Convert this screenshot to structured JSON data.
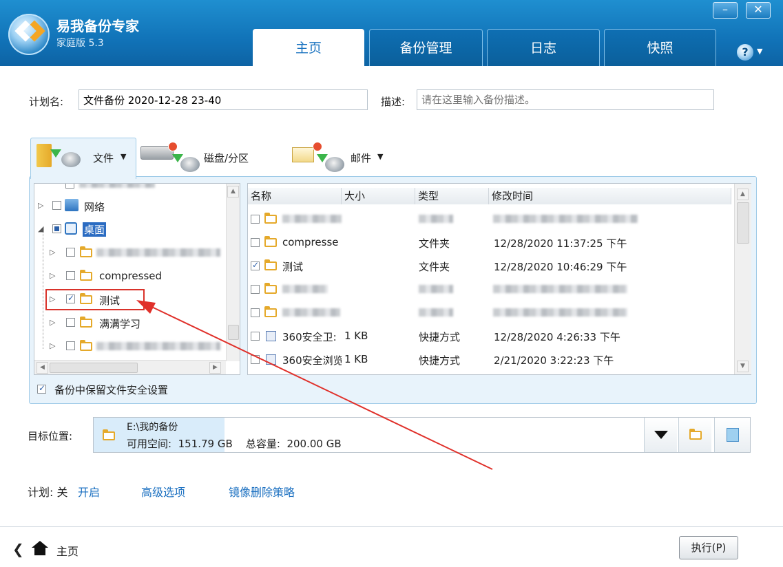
{
  "app": {
    "title": "易我备份专家",
    "subtitle": "家庭版 5.3"
  },
  "window_controls": {
    "minimize": "–",
    "close": "✕"
  },
  "tabs": [
    {
      "label": "主页",
      "active": true
    },
    {
      "label": "备份管理",
      "active": false
    },
    {
      "label": "日志",
      "active": false
    },
    {
      "label": "快照",
      "active": false
    }
  ],
  "help": {
    "label": "?",
    "arrow": "▼"
  },
  "plan": {
    "name_label": "计划名:",
    "name_value": "文件备份 2020-12-28 23-40",
    "desc_label": "描述:",
    "desc_placeholder": "请在这里输入备份描述。"
  },
  "types": {
    "file": {
      "label": "文件",
      "arrow": "▼"
    },
    "disk": {
      "label": "磁盘/分区"
    },
    "mail": {
      "label": "邮件",
      "arrow": "▼"
    }
  },
  "tree": {
    "items": [
      {
        "label": "网络",
        "checked": "none",
        "expander": "▷"
      },
      {
        "label": "桌面",
        "checked": "partial",
        "expander": "◢"
      },
      {
        "label": "",
        "checked": "none",
        "expander": "▷"
      },
      {
        "label": "compressed",
        "checked": "none",
        "expander": "▷"
      },
      {
        "label": "测试",
        "checked": "on",
        "expander": "▷"
      },
      {
        "label": "满满学习",
        "checked": "none",
        "expander": "▷"
      },
      {
        "label": "",
        "checked": "none",
        "expander": "▷"
      }
    ]
  },
  "list": {
    "headers": {
      "name": "名称",
      "size": "大小",
      "type": "类型",
      "modified": "修改时间"
    },
    "rows": [
      {
        "name": "",
        "size": "",
        "type": "",
        "modified": "",
        "checked": false,
        "icon": "folder"
      },
      {
        "name": "compresse",
        "size": "",
        "type": "文件夹",
        "modified": "12/28/2020 11:37:25  下午",
        "checked": false,
        "icon": "folder"
      },
      {
        "name": "测试",
        "size": "",
        "type": "文件夹",
        "modified": "12/28/2020 10:46:29  下午",
        "checked": true,
        "icon": "folder"
      },
      {
        "name": "",
        "size": "",
        "type": "",
        "modified": "",
        "checked": false,
        "icon": "folder"
      },
      {
        "name": "",
        "size": "",
        "type": "",
        "modified": "",
        "checked": false,
        "icon": "folder"
      },
      {
        "name": "360安全卫:",
        "size": "1 KB",
        "type": "快捷方式",
        "modified": "12/28/2020 4:26:33  下午",
        "checked": false,
        "icon": "shortcut"
      },
      {
        "name": "360安全浏览",
        "size": "1 KB",
        "type": "快捷方式",
        "modified": "2/21/2020 3:22:23  下午",
        "checked": false,
        "icon": "shortcut"
      }
    ]
  },
  "keep_security": {
    "label": "备份中保留文件安全设置",
    "checked": true
  },
  "target": {
    "label": "目标位置:",
    "path": "E:\\我的备份",
    "free_label": "可用空间:",
    "free_value": "151.79 GB",
    "total_label": "总容量:",
    "total_value": "200.00 GB"
  },
  "links": {
    "schedule_label": "计划: 关",
    "schedule_on": "开启",
    "advanced": "高级选项",
    "mirror": "镜像删除策略"
  },
  "footer": {
    "back_label": "主页",
    "execute": "执行(P)"
  },
  "colors": {
    "title_bar": "#1173b8",
    "accent": "#1a6fc0",
    "annotation": "#d9322a"
  }
}
